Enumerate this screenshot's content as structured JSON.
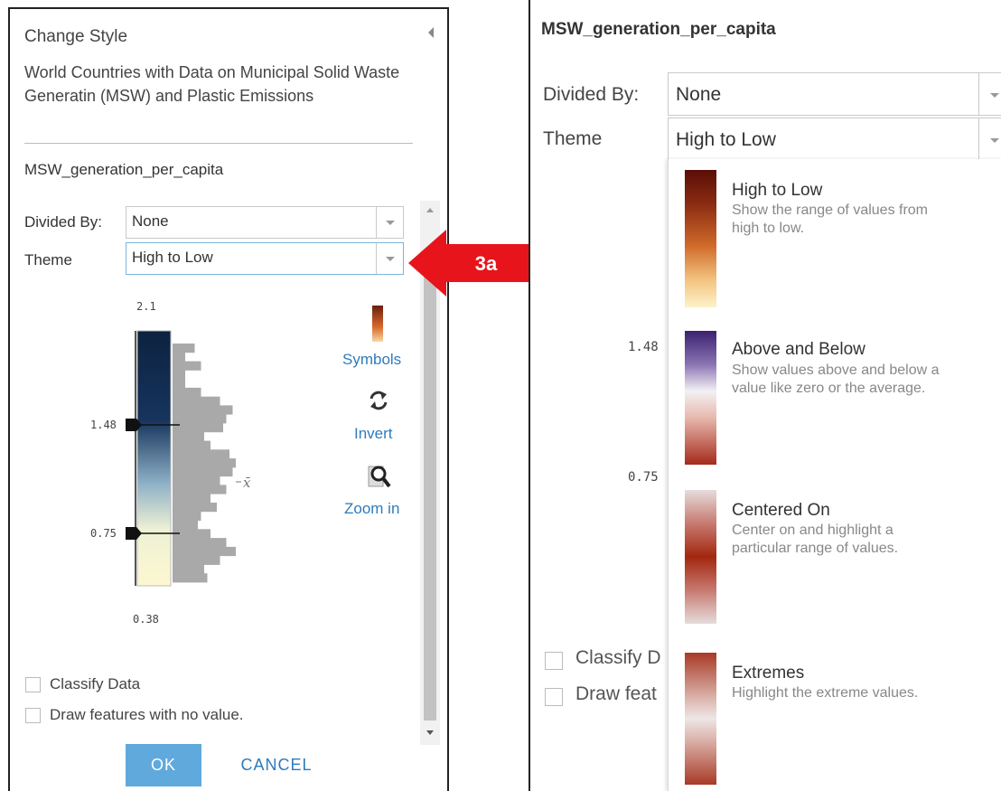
{
  "left_panel": {
    "title": "Change Style",
    "description": "World Countries with Data on Municipal Solid Waste Generatin (MSW) and Plastic Emissions",
    "field_name": "MSW_generation_per_capita",
    "divided_by": {
      "label": "Divided By:",
      "value": "None"
    },
    "theme": {
      "label": "Theme",
      "value": "High to Low"
    },
    "histogram": {
      "max_label": "2.1",
      "upper_handle": "1.48",
      "lower_handle": "0.75",
      "min_label": "0.38",
      "mean_symbol": "x̄",
      "bins": [
        0.35,
        0.2,
        0.45,
        0.2,
        0.2,
        0.45,
        0.75,
        0.95,
        0.85,
        0.8,
        0.5,
        0.6,
        0.9,
        1.0,
        0.95,
        0.75,
        0.85,
        0.6,
        0.7,
        0.45,
        0.4,
        0.6,
        0.85,
        1.0,
        0.75,
        0.5,
        0.55
      ]
    },
    "actions": [
      {
        "label": "Symbols",
        "icon": "symbols-gradient-icon"
      },
      {
        "label": "Invert",
        "icon": "invert-refresh-icon"
      },
      {
        "label": "Zoom in",
        "icon": "zoom-in-magnifier-icon"
      }
    ],
    "checkboxes": [
      {
        "label": "Classify Data",
        "checked": false
      },
      {
        "label": "Draw features with no value.",
        "checked": false
      }
    ],
    "ok_label": "OK",
    "cancel_label": "CANCEL"
  },
  "callout": {
    "label": "3a",
    "color": "#e8141b"
  },
  "right_panel": {
    "field_name": "MSW_generation_per_capita",
    "divided_by": {
      "label": "Divided By:",
      "value": "None"
    },
    "theme": {
      "label": "Theme",
      "value": "High to Low"
    },
    "behind_labels": {
      "upper": "1.48",
      "lower": "0.75"
    },
    "checkboxes_partial": [
      "Classify D",
      "Draw feat"
    ],
    "theme_options": [
      {
        "name": "High to Low",
        "desc": "Show the range of values from high to low.",
        "swatch": "high-to-low"
      },
      {
        "name": "Above and Below",
        "desc": "Show values above and below a value like zero or the average.",
        "swatch": "above-below"
      },
      {
        "name": "Centered On",
        "desc": "Center on and highlight a particular range of values.",
        "swatch": "centered-on"
      },
      {
        "name": "Extremes",
        "desc": "Highlight the extreme values.",
        "swatch": "extremes"
      }
    ]
  }
}
